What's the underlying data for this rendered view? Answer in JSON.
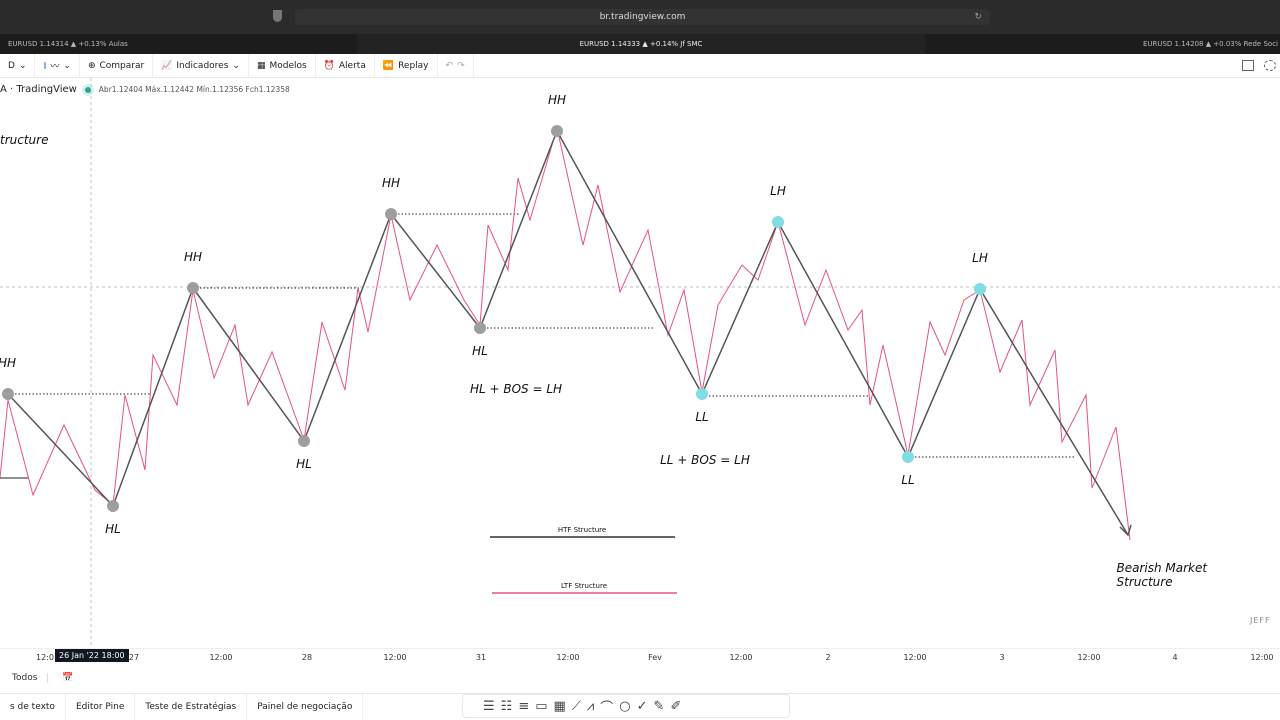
{
  "browser": {
    "url": "br.tradingview.com",
    "tabs": [
      "EURUSD 1.14314 ▲ +0.13% Aulas",
      "EURUSD 1.14333 ▲ +0.14% Jf SMC",
      "EURUSD 1.14208 ▲ +0.03% Rede Soci"
    ]
  },
  "toolbar": {
    "interval": "D",
    "compare": "Comparar",
    "indicators": "Indicadores",
    "templates": "Modelos",
    "alert": "Alerta",
    "replay": "Replay"
  },
  "legend": {
    "source": "A · TradingView",
    "ohlc": "Abr1.12404 Máx.1.12442 Mín.1.12356 Fch1.12358"
  },
  "annotations": {
    "title_partial": "tructure",
    "hh": "HH",
    "hl": "HL",
    "lh": "LH",
    "ll": "LL",
    "rule1": "HL + BOS = LH",
    "rule2": "LL + BOS = LH",
    "htf": "HTF Structure",
    "ltf": "LTF Structure",
    "bearish": "Bearish Market Structure",
    "watermark": "JEFF"
  },
  "colors": {
    "htf": "#555555",
    "ltf": "#e8537a",
    "hh_point": "#9e9e9e",
    "ll_point": "#7fdde6"
  },
  "timeaxis": {
    "ticks": [
      "12:0",
      "27",
      "12:00",
      "28",
      "12:00",
      "31",
      "12:00",
      "Fev",
      "12:00",
      "2",
      "12:00",
      "3",
      "12:00",
      "4",
      "12:00"
    ],
    "crosshair": "26 Jan '22   18:00"
  },
  "range": {
    "all": "Todos"
  },
  "bottom": {
    "tabs": [
      "s de texto",
      "Editor Pine",
      "Teste de Estratégias",
      "Painel de negociação"
    ]
  }
}
